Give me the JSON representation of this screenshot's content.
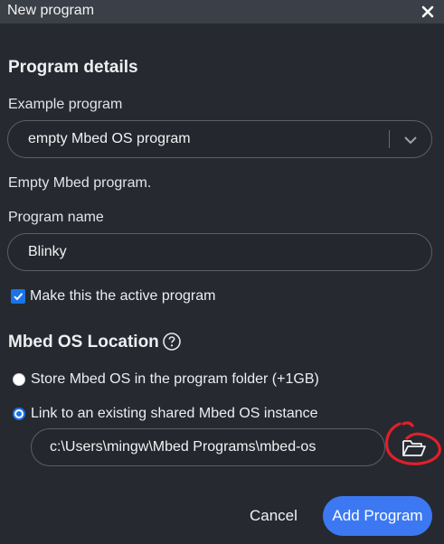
{
  "dialog": {
    "title": "New program",
    "close_icon": "close-icon"
  },
  "program_details": {
    "heading": "Program details",
    "example_label": "Example program",
    "example_value": "empty Mbed OS program",
    "example_description": "Empty Mbed program.",
    "name_label": "Program name",
    "name_value": "Blinky",
    "active_checkbox_label": "Make this the active program",
    "active_checked": true
  },
  "mbed_os_location": {
    "heading": "Mbed OS Location",
    "help_icon": "help-circle-icon",
    "options": [
      {
        "label": "Store Mbed OS in the program folder (+1GB)",
        "selected": false
      },
      {
        "label": "Link to an existing shared Mbed OS instance",
        "selected": true
      }
    ],
    "path_value": "c:\\Users\\mingw\\Mbed Programs\\mbed-os",
    "browse_icon": "folder-open-icon"
  },
  "footer": {
    "cancel_label": "Cancel",
    "add_label": "Add Program"
  },
  "colors": {
    "background": "#262930",
    "titlebar": "#3b3f47",
    "accent": "#3c78f2",
    "annotation": "#e0202a"
  }
}
